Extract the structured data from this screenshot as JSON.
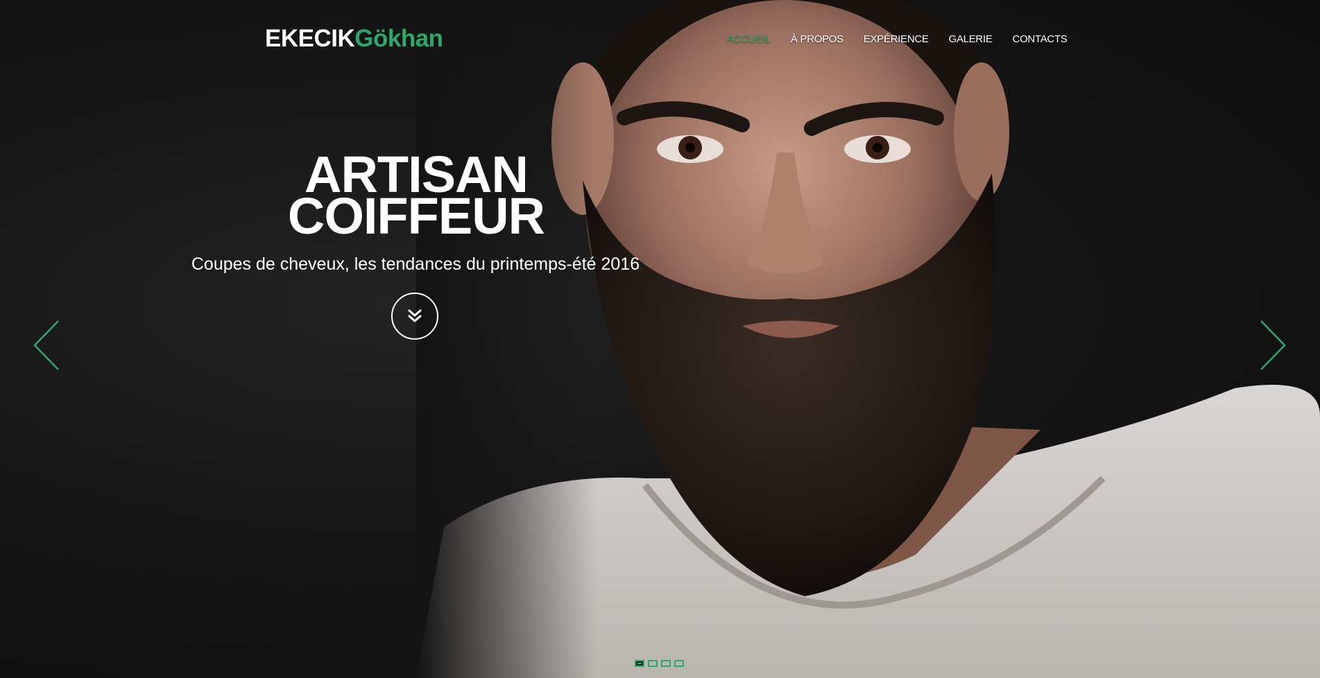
{
  "brand": {
    "first": "EKECIK",
    "second": "Gökhan"
  },
  "nav": {
    "items": [
      {
        "label": "ACCUEIL",
        "active": true
      },
      {
        "label": "À PROPOS",
        "active": false
      },
      {
        "label": "EXPÉRIENCE",
        "active": false
      },
      {
        "label": "GALERIE",
        "active": false
      },
      {
        "label": "CONTACTS",
        "active": false
      }
    ]
  },
  "hero": {
    "title_line1": "ARTISAN",
    "title_line2": "COIFFEUR",
    "subtitle": "Coupes de cheveux, les tendances du printemps-été 2016",
    "scroll_icon": "double-chevron-down-icon",
    "prev_icon": "chevron-left-icon",
    "next_icon": "chevron-right-icon"
  },
  "slider": {
    "slide_count": 4,
    "active_index": 0
  },
  "colors": {
    "accent": "#2ea86a",
    "text": "#ffffff",
    "background": "#121212"
  }
}
